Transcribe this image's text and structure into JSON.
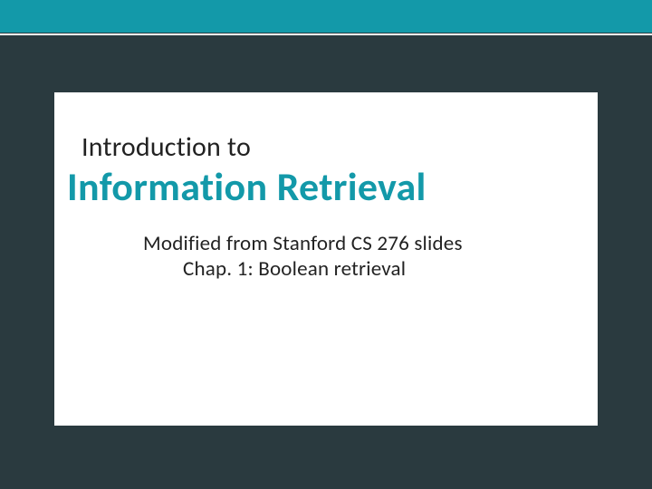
{
  "slide": {
    "pretitle": "Introduction to",
    "title": "Information Retrieval",
    "subtitle_line1": "Modified from Stanford CS 276 slides",
    "subtitle_line2": "Chap. 1: Boolean retrieval"
  },
  "colors": {
    "background": "#2a3a3f",
    "accent": "#1399a9",
    "panel": "#ffffff",
    "text": "#222222"
  }
}
